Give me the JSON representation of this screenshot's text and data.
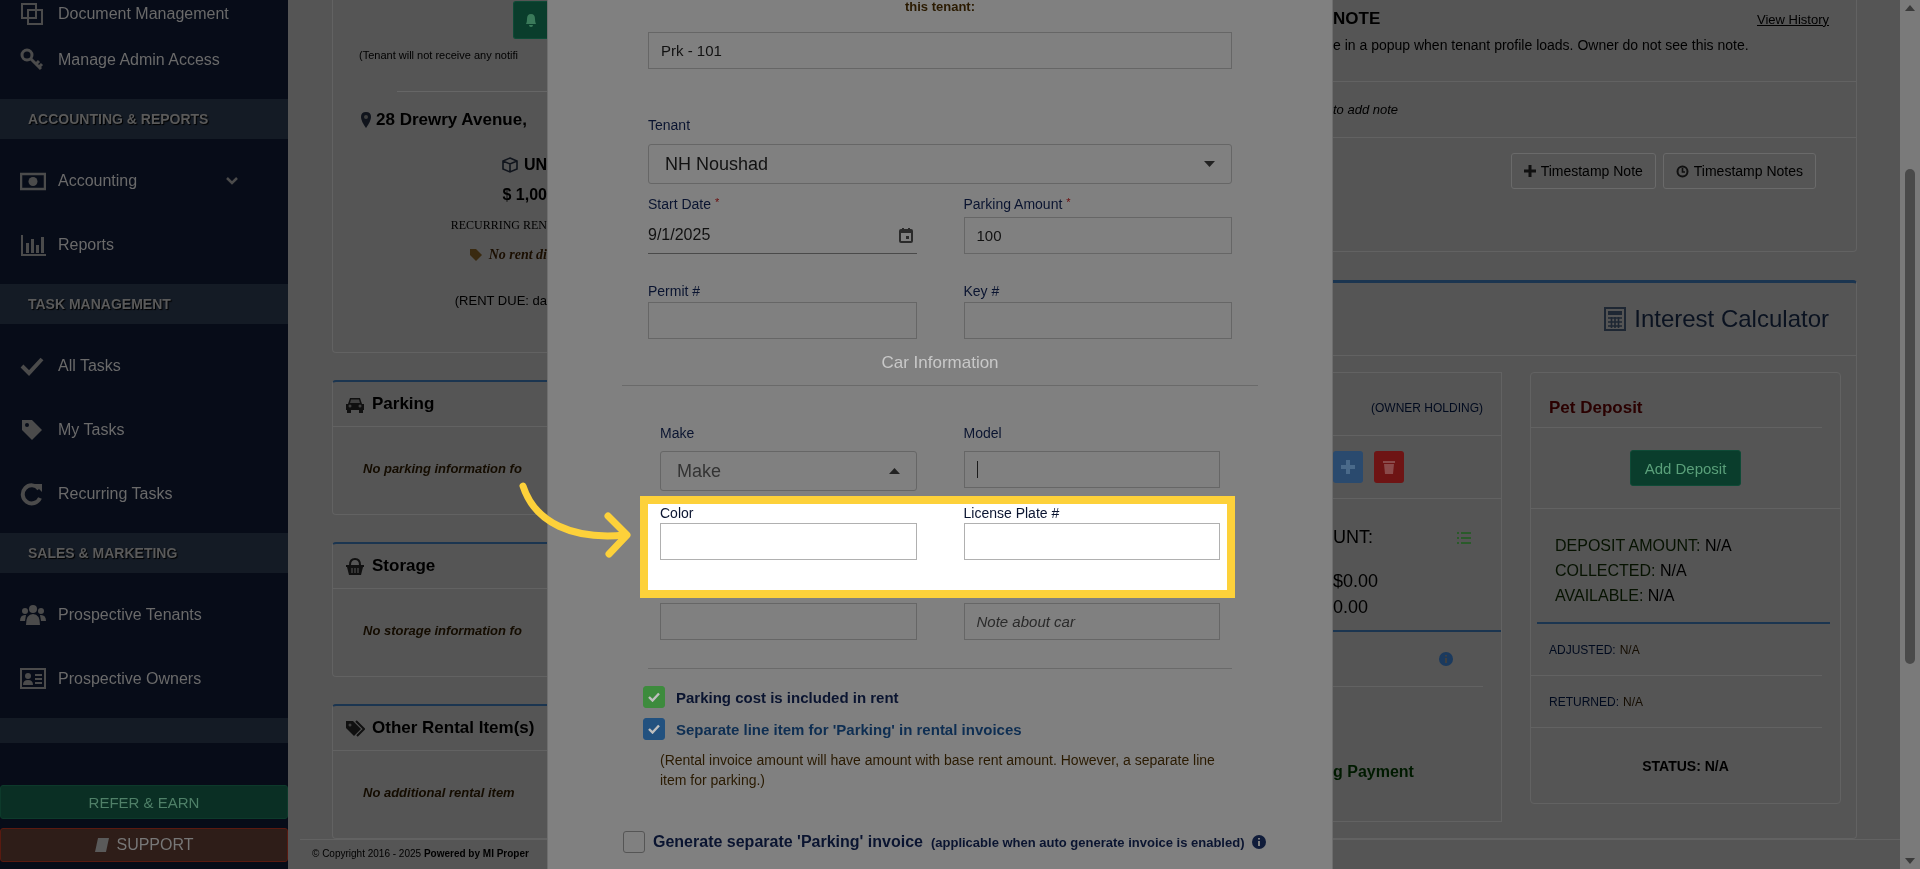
{
  "sidebar": {
    "items": [
      {
        "kind": "link",
        "label": "Document Management"
      },
      {
        "kind": "link",
        "label": "Manage Admin Access"
      },
      {
        "kind": "section",
        "label": "ACCOUNTING & REPORTS"
      },
      {
        "kind": "group",
        "label": "Accounting",
        "expanded": false
      },
      {
        "kind": "link",
        "label": "Reports"
      },
      {
        "kind": "section",
        "label": "TASK MANAGEMENT"
      },
      {
        "kind": "link",
        "label": "All Tasks"
      },
      {
        "kind": "link",
        "label": "My Tasks"
      },
      {
        "kind": "link",
        "label": "Recurring Tasks"
      },
      {
        "kind": "section",
        "label": "SALES & MARKETING"
      },
      {
        "kind": "link",
        "label": "Prospective Tenants"
      },
      {
        "kind": "link",
        "label": "Prospective Owners"
      }
    ],
    "buttons": [
      {
        "kind": "refer",
        "label": "REFER & EARN"
      },
      {
        "kind": "support",
        "label": "SUPPORT"
      }
    ]
  },
  "tenant_card": {
    "notice": "(Tenant will not receive any notifi",
    "address": "28 Drewry Avenue,",
    "unit": "UN",
    "rent": "$ 1,00",
    "rent_label": "RECURRING REN",
    "discount": "No rent di",
    "due": "(RENT DUE: da"
  },
  "panels": [
    {
      "kind": "parking",
      "title": "Parking",
      "message": "No parking information fo"
    },
    {
      "kind": "storage",
      "title": "Storage",
      "message": "No storage information fo"
    },
    {
      "kind": "other",
      "title": "Other Rental Item(s)",
      "message": "No additional rental item"
    }
  ],
  "footer": "© Copyright 2016 - 2025 **Powered by MI Proper**",
  "note_card": {
    "title": "NOTE",
    "link": "View History",
    "description": "e in a popup when tenant profile loads. Owner do not see this note.",
    "prompt": "to add note",
    "buttons": [
      {
        "kind": "add",
        "label": "Timestamp Note"
      },
      {
        "kind": "clock",
        "label": "Timestamp Notes"
      }
    ]
  },
  "interest": {
    "title": "Interest Calculator",
    "holding": {
      "tag": "(OWNER HOLDING)",
      "amount_label": "UNT:",
      "amounts": [
        "$0.00",
        "0.00"
      ],
      "action": "g Payment"
    },
    "pet": {
      "title": "Pet Deposit",
      "button": "Add Deposit",
      "stats": [
        {
          "label": "DEPOSIT AMOUNT:",
          "value": "N/A"
        },
        {
          "label": "COLLECTED:",
          "value": "N/A"
        },
        {
          "label": "AVAILABLE:",
          "value": "N/A"
        }
      ],
      "details": [
        {
          "label": "ADJUSTED:",
          "value": "N/A"
        },
        {
          "label": "RETURNED:",
          "value": "N/A"
        }
      ],
      "status": "STATUS: N/A"
    }
  },
  "modal": {
    "heading": "this tenant:",
    "rows": [
      {
        "fields": [
          {
            "kind": "text",
            "value": "Prk - 101"
          }
        ]
      },
      {
        "fields": [
          {
            "kind": "select",
            "label": "Tenant",
            "value": "NH Noushad",
            "expanded": false
          }
        ]
      },
      {
        "fields": [
          {
            "kind": "date",
            "label": "Start Date",
            "required_mark": "*",
            "value": "9/1/2025"
          },
          {
            "kind": "text",
            "label": "Parking Amount",
            "required_mark": "*",
            "value": "100"
          }
        ]
      },
      {
        "fields": [
          {
            "kind": "text",
            "label": "Permit #"
          },
          {
            "kind": "text",
            "label": "Key #"
          }
        ]
      }
    ],
    "section_title": "Car Information",
    "car_rows": [
      {
        "highlighted": false,
        "fields": [
          {
            "kind": "select",
            "label": "Make",
            "placeholder": "Make",
            "expanded": true
          },
          {
            "kind": "text",
            "label": "Model",
            "focused": true
          }
        ]
      },
      {
        "highlighted": true,
        "fields": [
          {
            "kind": "text",
            "label": "Color",
            "focused": false
          },
          {
            "kind": "text",
            "label": "License Plate #",
            "focused": false
          }
        ]
      },
      {
        "highlighted": false,
        "fields": [
          {
            "kind": "text",
            "focused": false
          },
          {
            "kind": "text",
            "placeholder": "Note about car",
            "focused": false
          }
        ]
      }
    ],
    "checkboxes": [
      {
        "kind": "success",
        "label": "Parking cost is included in rent",
        "checked": true,
        "color": "#3d8b3d"
      },
      {
        "kind": "info",
        "label": "Separate line item for 'Parking' in rental invoices",
        "checked": true,
        "color": "#22517f",
        "note": "(Rental invoice amount will have amount with base rent amount. However, a separate line item for parking.)"
      }
    ],
    "invoice_option": {
      "label": "Generate separate 'Parking' invoice",
      "hint": "(applicable when auto generate invoice is enabled)",
      "checked": false
    }
  }
}
